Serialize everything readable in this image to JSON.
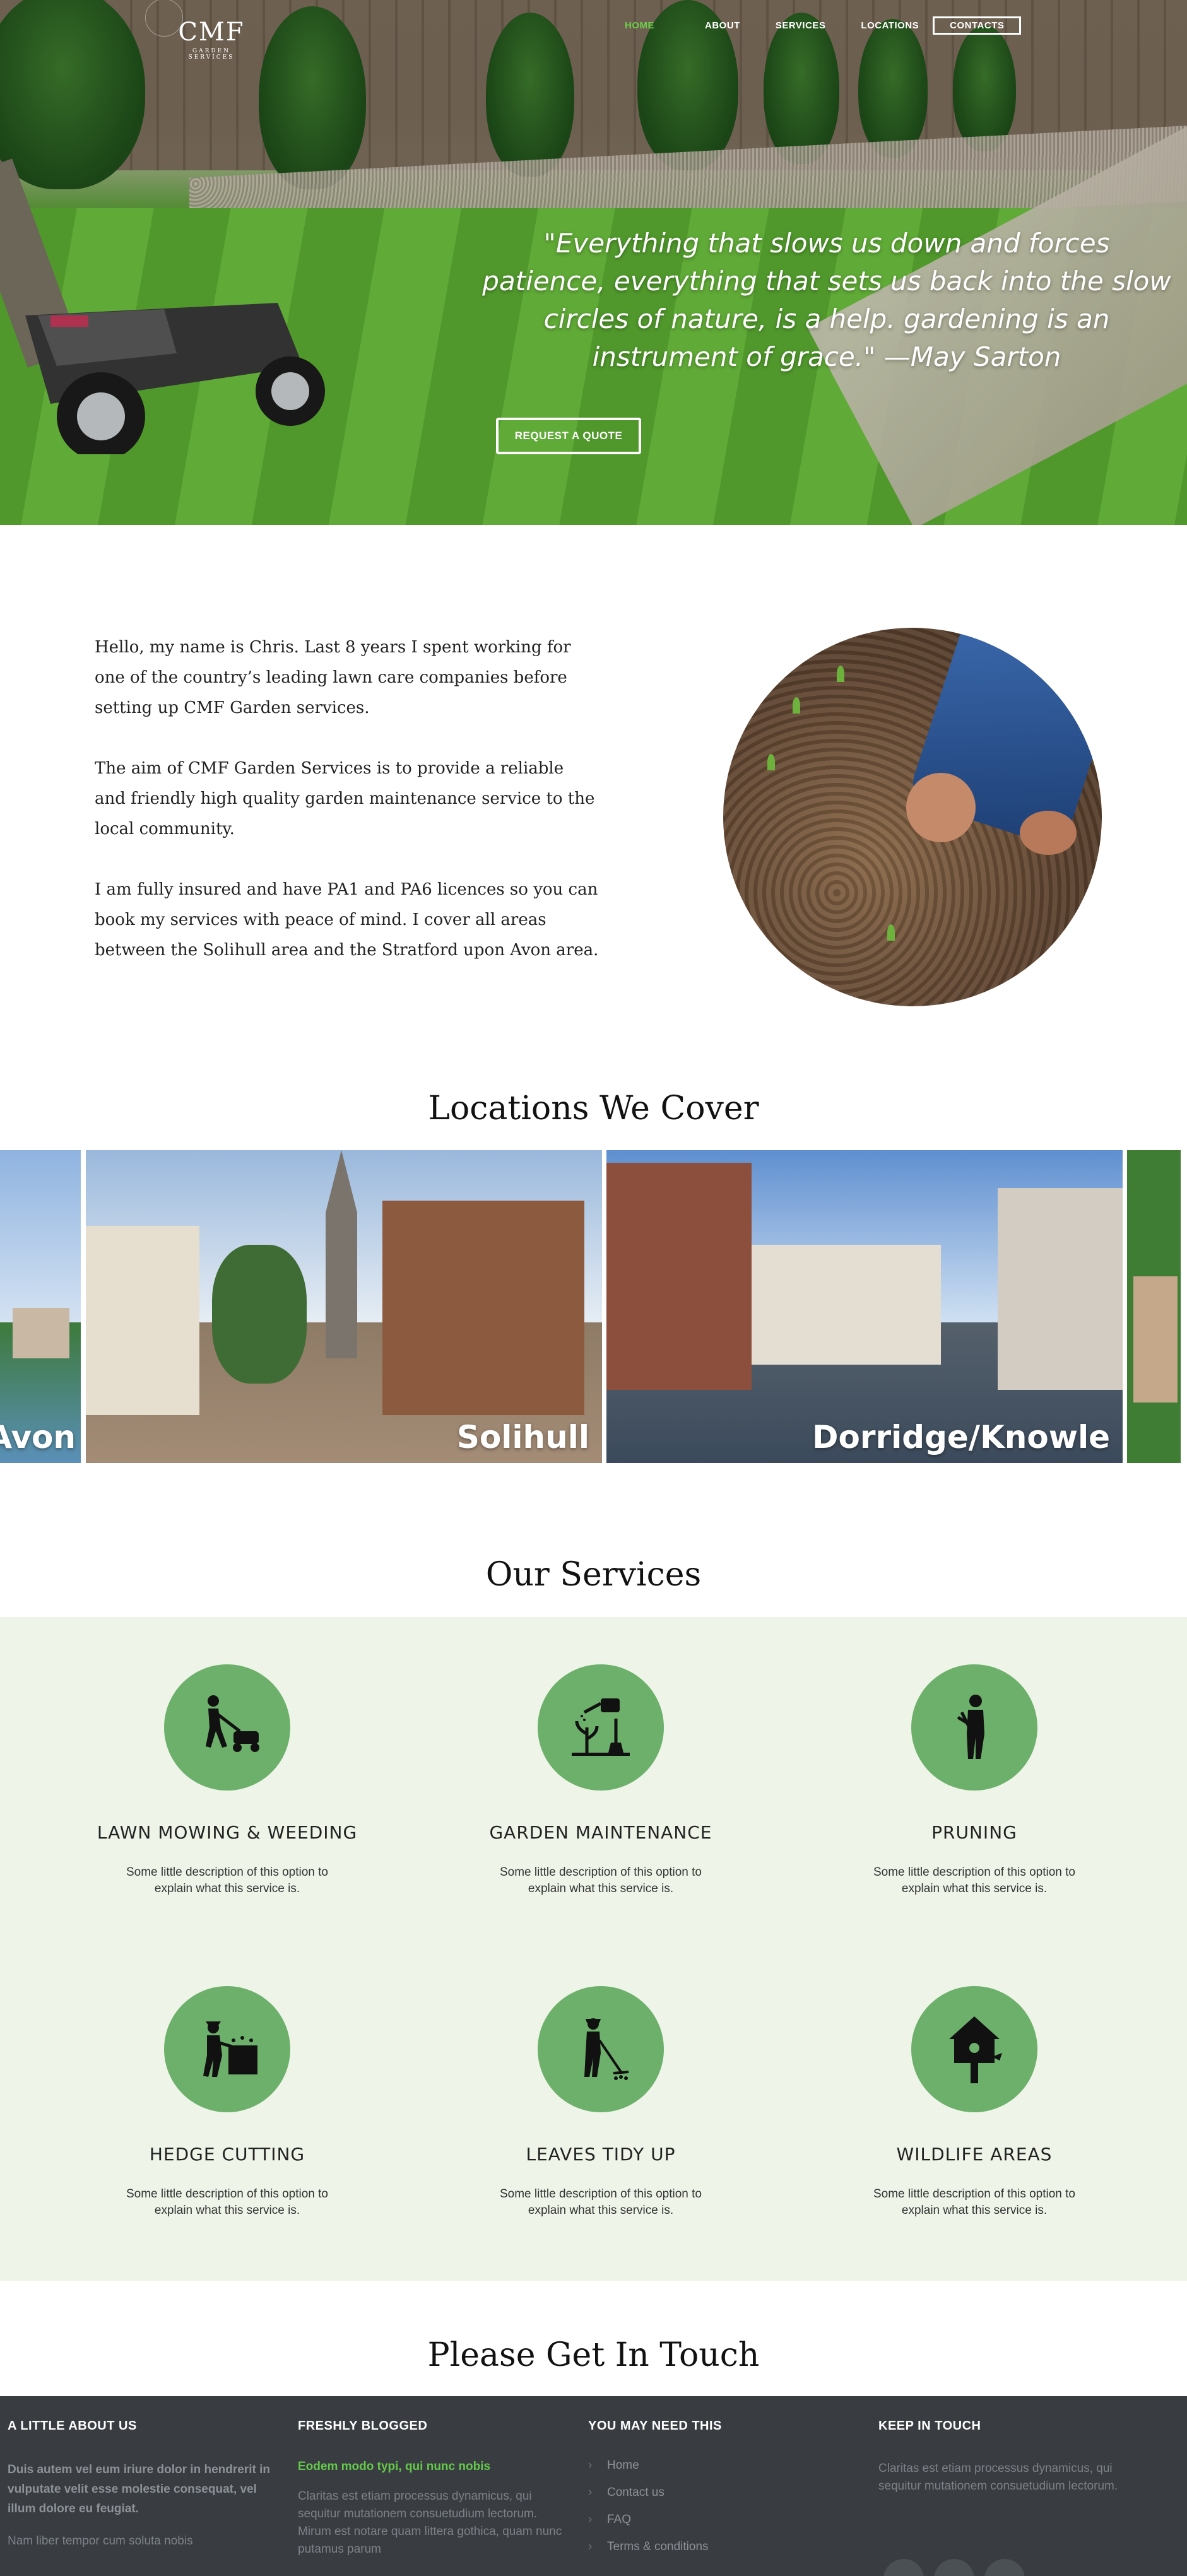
{
  "brand": {
    "logo_text": "CMF",
    "logo_sub": "GARDEN SERVICES"
  },
  "nav": {
    "home": "HOME",
    "about": "ABOUT",
    "services": "SERVICES",
    "locations": "LOCATIONS",
    "contacts": "CONTACTS"
  },
  "hero": {
    "quote_line1": "\"Everything that slows us down and forces",
    "quote_line2": "patience, everything that sets us back into the slow",
    "quote_line3": "circles of nature, is a help. gardening is an",
    "quote_line4": "instrument of grace.\" —May Sarton",
    "cta": "REQUEST A QUOTE"
  },
  "about": {
    "p1": "Hello, my name is Chris. Last 8 years I spent working for one of the country’s leading lawn care companies  before setting up CMF Garden services.",
    "p2": "The aim of CMF Garden Services is to provide a reliable and  friendly high quality garden maintenance service to the local community.",
    "p3": "I am fully insured and have  PA1 and PA6 licences so you can book my services with peace of mind. I cover all areas between the  Solihull area and the Stratford upon Avon area."
  },
  "locations": {
    "title": "Locations We Cover",
    "items": [
      {
        "label": "Avon"
      },
      {
        "label": "Solihull"
      },
      {
        "label": "Dorridge/Knowle"
      }
    ]
  },
  "services": {
    "title": "Our Services",
    "items": [
      {
        "title": "LAWN MOWING & WEEDING",
        "desc": "Some little  description of this option to explain what this service is.",
        "icon": "lawn-mower-icon"
      },
      {
        "title": "GARDEN MAINTENANCE",
        "desc": "Some little  description of this option to explain what this service is.",
        "icon": "watering-can-icon"
      },
      {
        "title": "PRUNING",
        "desc": "Some little  description of this option to explain what this service is.",
        "icon": "shears-icon"
      },
      {
        "title": "HEDGE CUTTING",
        "desc": "Some little  description of this option to explain what this service is.",
        "icon": "hedge-trimmer-icon"
      },
      {
        "title": "LEAVES TIDY UP",
        "desc": "Some little  description of this option to explain what this service is.",
        "icon": "rake-icon"
      },
      {
        "title": "WILDLIFE AREAS",
        "desc": "Some little  description of this option to explain what this service is.",
        "icon": "birdhouse-icon"
      }
    ],
    "accent": "#6db06b",
    "background": "#eef5e8"
  },
  "contact": {
    "title": "Please Get In Touch"
  },
  "footer": {
    "about_title": "A LITTLE ABOUT US",
    "about_strong": "Duis autem vel eum iriure dolor in hendrerit in vulputate velit esse molestie consequat, vel illum dolore eu feugiat.",
    "about_more": "Nam liber tempor cum soluta nobis",
    "blog_title": "FRESHLY BLOGGED",
    "blog_link": "Eodem modo typi, qui nunc nobis",
    "blog_text": "Claritas est etiam processus dynamicus, qui sequitur mutationem consuetudium lectorum. Mirum est notare quam littera gothica, quam nunc putamus parum",
    "links_title": "YOU MAY NEED THIS",
    "links": [
      "Home",
      "Contact us",
      "FAQ",
      "Terms & conditions"
    ],
    "keep_title": "KEEP IN TOUCH",
    "keep_text": "Claritas est etiam processus dynamicus, qui sequitur mutationem consuetudium lectorum.",
    "background": "#393d42",
    "accent": "#64c94a"
  }
}
